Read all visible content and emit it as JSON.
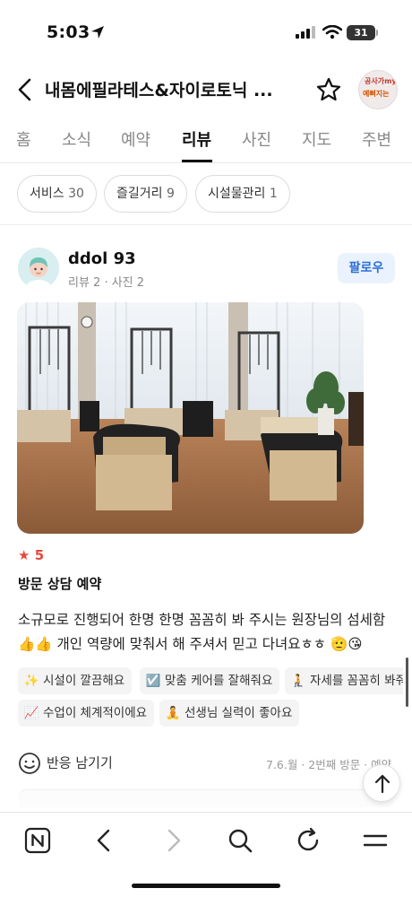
{
  "status_bar": {
    "time": "5:03",
    "battery": "31"
  },
  "header": {
    "title": "내몸에필라테스&자이로토닉 ...",
    "thumb_text_1": "공사가my",
    "thumb_text_2": "예뻐지는"
  },
  "tabs": [
    "홈",
    "소식",
    "예약",
    "리뷰",
    "사진",
    "지도",
    "주변"
  ],
  "active_tab": "리뷰",
  "filters": [
    {
      "label": "서비스",
      "count": "30"
    },
    {
      "label": "즐길거리",
      "count": "9"
    },
    {
      "label": "시설물관리",
      "count": "1"
    }
  ],
  "review": {
    "author": "ddol 93",
    "meta": "리뷰 2 · 사진 2",
    "follow_label": "팔로우",
    "rating_star": "★",
    "rating": "5",
    "visit_title": "방문 상담 예약",
    "text_line1": "소규모로 진행되어 한명 한명 꼼꼼히 봐 주시는 원장님의 섬세함",
    "text_line2_emoji": "👍👍",
    "text_line2": "개인 역량에 맞춰서 해 주셔서 믿고 다녀요ㅎㅎ",
    "text_line2_tail_emoji": "🫡😘",
    "tags": [
      {
        "emoji": "✨",
        "label": "시설이 깔끔해요"
      },
      {
        "emoji": "☑️",
        "label": "맞춤 케어를 잘해줘요"
      },
      {
        "emoji": "🧎",
        "label": "자세를 꼼꼼히 봐줘요"
      },
      {
        "emoji": "📈",
        "label": "수업이 체계적이에요"
      },
      {
        "emoji": "🧘",
        "label": "선생님 실력이 좋아요"
      }
    ],
    "reaction_label": "반응 남기기",
    "visit_meta": "7.6.월 · 2번째 방문 · 예약"
  },
  "icons": {
    "back": "chevron-left-icon",
    "favorite": "star-outline-icon",
    "reaction": "smile-icon",
    "scroll_top": "arrow-up-icon",
    "toolbar": [
      "naver-home-icon",
      "back-arrow-icon",
      "forward-arrow-icon",
      "search-icon",
      "refresh-icon",
      "menu-icon"
    ]
  },
  "colors": {
    "accent_blue": "#2a6fd6",
    "rating_red": "#e8473c"
  }
}
